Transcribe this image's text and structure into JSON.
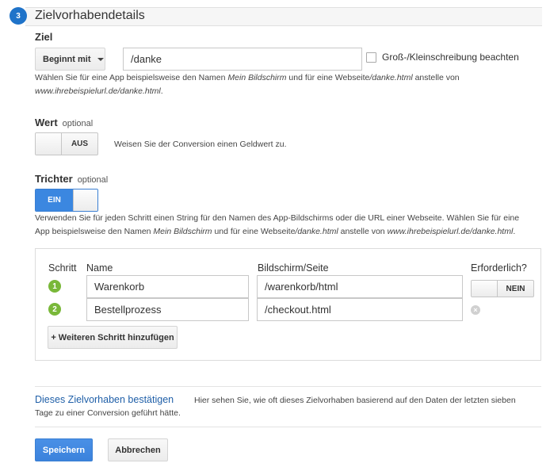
{
  "section": {
    "step_number": "3",
    "title": "Zielvorhabendetails"
  },
  "goal": {
    "label": "Ziel",
    "match_type": "Beginnt mit",
    "value": "/danke",
    "case_sensitive_label": "Groß-/Kleinschreibung beachten",
    "case_sensitive_checked": false,
    "help_1": "Wählen Sie für eine App beispielsweise den Namen ",
    "help_em_1": "Mein Bildschirm",
    "help_2": " und für eine Webseite",
    "help_em_2": "/danke.html",
    "help_3": " anstelle von",
    "help_em_3": "www.ihrebeispielurl.de/danke.html",
    "help_4": "."
  },
  "value": {
    "label": "Wert",
    "optional": "optional",
    "toggle_state": "AUS",
    "help": "Weisen Sie der Conversion einen Geldwert zu."
  },
  "funnel": {
    "label": "Trichter",
    "optional": "optional",
    "toggle_state": "EIN",
    "help_1": "Verwenden Sie für jeden Schritt einen String für den Namen des App-Bildschirms oder die URL einer Webseite. Wählen Sie für eine",
    "help_2": "App beispielsweise den Namen ",
    "help_em_1": "Mein Bildschirm",
    "help_3": " und für eine Webseite",
    "help_em_2": "/danke.html",
    "help_4": " anstelle von ",
    "help_em_3": "www.ihrebeispielurl.de/danke.html",
    "help_5": ".",
    "columns": {
      "step": "Schritt",
      "name": "Name",
      "page": "Bildschirm/Seite",
      "required": "Erforderlich?"
    },
    "steps": [
      {
        "number": "1",
        "name": "Warenkorb",
        "page": "/warenkorb/html"
      },
      {
        "number": "2",
        "name": "Bestellprozess",
        "page": "/checkout.html"
      }
    ],
    "required_toggle": "NEIN",
    "add_step_label": "+ Weiteren Schritt hinzufügen",
    "remove_symbol": "×"
  },
  "verify": {
    "link": "Dieses Zielvorhaben bestätigen",
    "text_1": "Hier sehen Sie, wie oft dieses Zielvorhaben basierend auf den Daten der letzten sieben",
    "text_2": "Tage zu einer Conversion geführt hätte."
  },
  "actions": {
    "save": "Speichern",
    "cancel": "Abbrechen"
  },
  "colors": {
    "accent_blue": "#3b87e0",
    "step_circle": "#1f73c9",
    "step_green": "#79b839",
    "link_blue": "#1f5fa8"
  }
}
